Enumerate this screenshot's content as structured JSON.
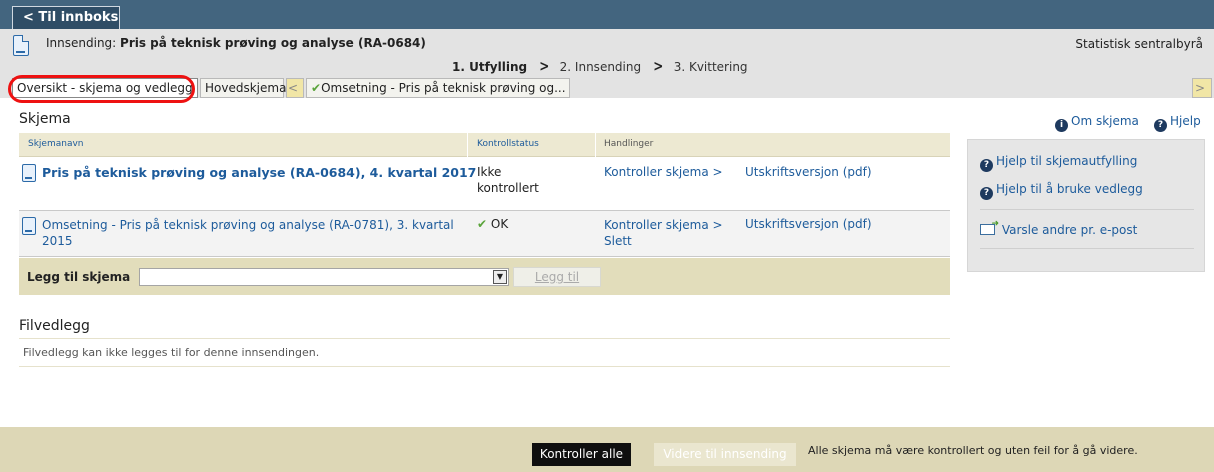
{
  "topbar": {
    "back_label": "< Til innboks"
  },
  "header": {
    "innsending_prefix": "Innsending: ",
    "innsending_title": "Pris på teknisk prøving og analyse (RA-0684)",
    "organization": "Statistisk sentralbyrå",
    "steps": [
      "1. Utfylling",
      "2. Innsending",
      "3. Kvittering"
    ]
  },
  "tabs": {
    "overview": "Oversikt - skjema og vedlegg",
    "main_form": "Hovedskjema",
    "prev_arrow": "<",
    "next_arrow": ">",
    "sub_form": "Omsetning - Pris på teknisk prøving og..."
  },
  "forms": {
    "title": "Skjema",
    "columns": [
      "Skjemanavn",
      "Kontrollstatus",
      "Handlinger"
    ],
    "rows": [
      {
        "name": "Pris på teknisk prøving og analyse (RA-0684), 4. kvartal 2017",
        "status_line1": "Ikke",
        "status_line2": "kontrollert",
        "action_check": "Kontroller skjema >",
        "action_print": "Utskriftsversjon (pdf)"
      },
      {
        "name_line1": "Omsetning - Pris på teknisk prøving og analyse (RA-0781), 3. kvartal",
        "name_line2": "2015",
        "status": "OK",
        "action_check": "Kontroller skjema >",
        "action_delete": "Slett",
        "action_print": "Utskriftsversjon (pdf)"
      }
    ],
    "add_label": "Legg til skjema",
    "add_button": "Legg til"
  },
  "attachments": {
    "title": "Filvedlegg",
    "note": "Filvedlegg kan ikke legges til for denne innsendingen."
  },
  "help": {
    "about_form": "Om skjema",
    "help": "Hjelp",
    "panel_items": [
      "Hjelp til skjemautfylling",
      "Hjelp til å bruke vedlegg",
      "Varsle andre pr. e-post"
    ]
  },
  "bottom": {
    "check_all": "Kontroller alle",
    "continue": "Videre til innsending",
    "note": "Alle skjema må være kontrollert og uten feil for å gå videre."
  },
  "colors": {
    "topbar": "#43657f",
    "accent_link": "#1d5b9b",
    "highlight_oval": "#ee1111",
    "ok_check": "#5aa43a"
  }
}
